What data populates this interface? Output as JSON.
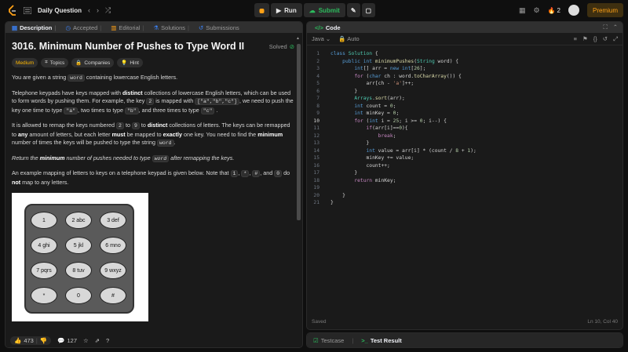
{
  "topbar": {
    "daily_label": "Daily Question",
    "run_label": "Run",
    "submit_label": "Submit",
    "streak_count": "2",
    "premium_label": "Premium"
  },
  "left": {
    "tabs": [
      {
        "label": "Description"
      },
      {
        "label": "Accepted"
      },
      {
        "label": "Editorial"
      },
      {
        "label": "Solutions"
      },
      {
        "label": "Submissions"
      }
    ]
  },
  "problem": {
    "title": "3016. Minimum Number of Pushes to Type Word II",
    "solved_label": "Solved",
    "chips": {
      "difficulty": "Medium",
      "topics": "Topics",
      "companies": "Companies",
      "hint": "Hint"
    },
    "p1_a": "You are given a string ",
    "p1_code": "word",
    "p1_b": " containing lowercase English letters.",
    "p2_a": "Telephone keypads have keys mapped with ",
    "p2_b1": "distinct",
    "p2_c": " collections of lowercase English letters, which can be used to form words by pushing them. For example, the key ",
    "p2_code1": "2",
    "p2_d": " is mapped with ",
    "p2_code2": "[\"a\",\"b\",\"c\"]",
    "p2_e": ", we need to push the key one time to type ",
    "p2_code3": "\"a\"",
    "p2_f": ", two times to type ",
    "p2_code4": "\"b\"",
    "p2_g": ", and three times to type ",
    "p2_code5": "\"c\"",
    "p2_h": " .",
    "p3_a": "It is allowed to remap the keys numbered ",
    "p3_code1": "2",
    "p3_b": " to ",
    "p3_code2": "9",
    "p3_c": " to ",
    "p3_b1": "distinct",
    "p3_d": " collections of letters. The keys can be remapped to ",
    "p3_b2": "any",
    "p3_e": " amount of letters, but each letter ",
    "p3_b3": "must",
    "p3_f": " be mapped to ",
    "p3_b4": "exactly",
    "p3_g": " one key. You need to find the ",
    "p3_b5": "minimum",
    "p3_h": " number of times the keys will be pushed to type the string ",
    "p3_code3": "word",
    "p3_i": ".",
    "p4_a": "Return the ",
    "p4_b": "minimum",
    "p4_c": " number of pushes needed to type ",
    "p4_code": "word",
    "p4_d": " after remapping the keys.",
    "p5_a": "An example mapping of letters to keys on a telephone keypad is given below. Note that ",
    "p5_code1": "1",
    "p5_sep1": ", ",
    "p5_code2": "*",
    "p5_sep2": ", ",
    "p5_code3": "#",
    "p5_b": ", and ",
    "p5_code4": "0",
    "p5_c": " do ",
    "p5_bold": "not",
    "p5_d": " map to any letters.",
    "keys": [
      "1",
      "2 abc",
      "3 def",
      "4 ghi",
      "5 jkl",
      "6 mno",
      "7 pqrs",
      "8 tuv",
      "9 wxyz",
      "*",
      "0",
      "#"
    ]
  },
  "footer": {
    "likes": "473",
    "comments": "127"
  },
  "code": {
    "tab_label": "Code",
    "language": "Java",
    "auto_label": "Auto",
    "status": "Saved",
    "cursor": "Ln 10, Col 40",
    "lines": [
      "class Solution {",
      "    public int minimumPushes(String word) {",
      "        int[] arr = new int[26];",
      "        for (char ch : word.toCharArray()) {",
      "            arr[ch - 'a']++;",
      "        }",
      "        Arrays.sort(arr);",
      "        int count = 0;",
      "        int minKey = 0;",
      "        for (int i = 25; i >= 0; i--) {",
      "            if(arr[i]==0){",
      "                break;",
      "            }",
      "            int value = arr[i] * (count / 8 + 1);",
      "            minKey += value;",
      "            count++;",
      "        }",
      "        return minKey;",
      "",
      "    }",
      "}"
    ],
    "line_numbers": [
      "1",
      "2",
      "3",
      "4",
      "5",
      "6",
      "7",
      "8",
      "9",
      "10",
      "11",
      "12",
      "13",
      "14",
      "15",
      "16",
      "17",
      "18",
      "19",
      "20",
      "21"
    ]
  },
  "bottom": {
    "testcase_label": "Testcase",
    "result_label": "Test Result"
  }
}
